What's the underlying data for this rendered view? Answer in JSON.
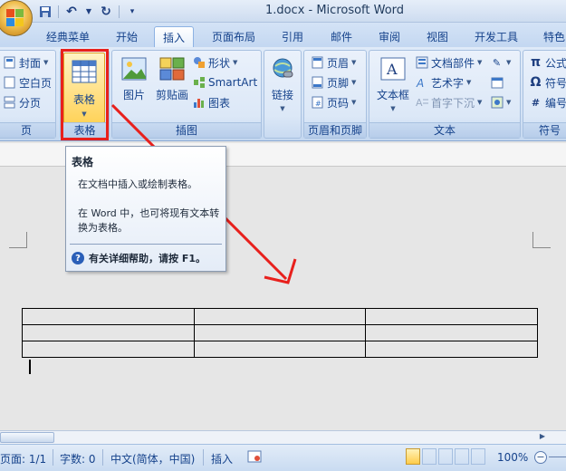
{
  "window": {
    "title": "1.docx - Microsoft Word"
  },
  "qat": {
    "buttons": [
      "save-icon",
      "undo-icon",
      "redo-icon",
      "customize-icon"
    ]
  },
  "tabs": [
    "经典菜单",
    "开始",
    "插入",
    "页面布局",
    "引用",
    "邮件",
    "审阅",
    "视图",
    "开发工具",
    "特色"
  ],
  "active_tab": "插入",
  "ribbon": {
    "page_group": {
      "label": "页",
      "items": [
        "封面",
        "空白页",
        "分页"
      ]
    },
    "table_group": {
      "label": "表格",
      "button": "表格"
    },
    "illustrations_group": {
      "label": "插图",
      "picture": "图片",
      "clipart": "剪贴画",
      "shapes": "形状",
      "smartart": "SmartArt",
      "chart": "图表"
    },
    "links_group": {
      "button": "链接"
    },
    "header_footer_group": {
      "label": "页眉和页脚",
      "items": [
        "页眉",
        "页脚",
        "页码"
      ]
    },
    "text_group": {
      "label": "文本",
      "textbox": "文本框",
      "items": [
        "文档部件",
        "艺术字",
        "首字下沉"
      ]
    },
    "symbols_group": {
      "label": "符号",
      "items": [
        "公式",
        "符号",
        "编号"
      ]
    }
  },
  "tooltip": {
    "title": "表格",
    "line1": "在文档中插入或绘制表格。",
    "line2": "在 Word 中，也可将现有文本转换为表格。",
    "help": "有关详细帮助，请按 F1。"
  },
  "statusbar": {
    "page": "页面: 1/1",
    "words": "字数: 0",
    "language": "中文(简体，中国)",
    "mode": "插入",
    "zoom": "100%"
  },
  "colors": {
    "highlight_red": "#e8201c",
    "arrow_red": "#e8201c",
    "ribbon_blue": "#15428b"
  }
}
